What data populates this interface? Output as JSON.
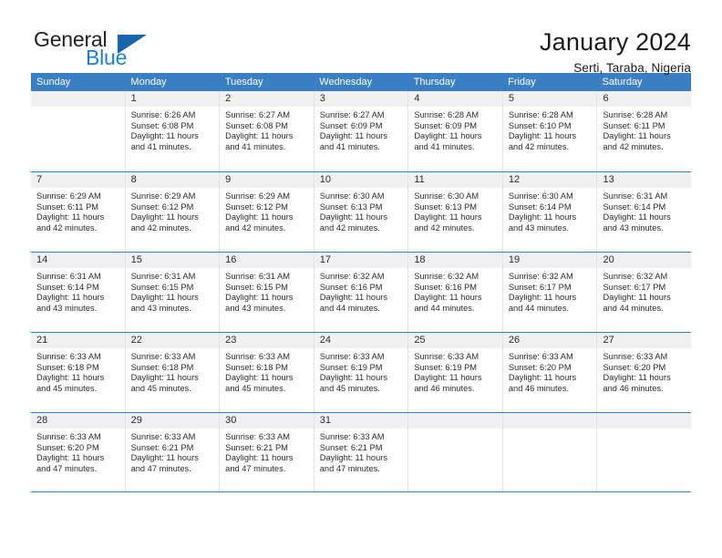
{
  "logo": {
    "general": "General",
    "blue": "Blue",
    "triangle_color": "#1665ad",
    "blue_color": "#1a7fd4"
  },
  "header": {
    "title": "January 2024",
    "subtitle": "Serti, Taraba, Nigeria"
  },
  "theme": {
    "header_row_color": "#3a7fc4",
    "daynum_bg": "#f0f0f0",
    "grid_line": "#e3e3e3"
  },
  "calendar": {
    "weekdays": [
      "Sunday",
      "Monday",
      "Tuesday",
      "Wednesday",
      "Thursday",
      "Friday",
      "Saturday"
    ],
    "weeks": [
      [
        {
          "day": "",
          "lines": []
        },
        {
          "day": "1",
          "lines": [
            "Sunrise: 6:26 AM",
            "Sunset: 6:08 PM",
            "Daylight: 11 hours",
            "and 41 minutes."
          ]
        },
        {
          "day": "2",
          "lines": [
            "Sunrise: 6:27 AM",
            "Sunset: 6:08 PM",
            "Daylight: 11 hours",
            "and 41 minutes."
          ]
        },
        {
          "day": "3",
          "lines": [
            "Sunrise: 6:27 AM",
            "Sunset: 6:09 PM",
            "Daylight: 11 hours",
            "and 41 minutes."
          ]
        },
        {
          "day": "4",
          "lines": [
            "Sunrise: 6:28 AM",
            "Sunset: 6:09 PM",
            "Daylight: 11 hours",
            "and 41 minutes."
          ]
        },
        {
          "day": "5",
          "lines": [
            "Sunrise: 6:28 AM",
            "Sunset: 6:10 PM",
            "Daylight: 11 hours",
            "and 42 minutes."
          ]
        },
        {
          "day": "6",
          "lines": [
            "Sunrise: 6:28 AM",
            "Sunset: 6:11 PM",
            "Daylight: 11 hours",
            "and 42 minutes."
          ]
        }
      ],
      [
        {
          "day": "7",
          "lines": [
            "Sunrise: 6:29 AM",
            "Sunset: 6:11 PM",
            "Daylight: 11 hours",
            "and 42 minutes."
          ]
        },
        {
          "day": "8",
          "lines": [
            "Sunrise: 6:29 AM",
            "Sunset: 6:12 PM",
            "Daylight: 11 hours",
            "and 42 minutes."
          ]
        },
        {
          "day": "9",
          "lines": [
            "Sunrise: 6:29 AM",
            "Sunset: 6:12 PM",
            "Daylight: 11 hours",
            "and 42 minutes."
          ]
        },
        {
          "day": "10",
          "lines": [
            "Sunrise: 6:30 AM",
            "Sunset: 6:13 PM",
            "Daylight: 11 hours",
            "and 42 minutes."
          ]
        },
        {
          "day": "11",
          "lines": [
            "Sunrise: 6:30 AM",
            "Sunset: 6:13 PM",
            "Daylight: 11 hours",
            "and 42 minutes."
          ]
        },
        {
          "day": "12",
          "lines": [
            "Sunrise: 6:30 AM",
            "Sunset: 6:14 PM",
            "Daylight: 11 hours",
            "and 43 minutes."
          ]
        },
        {
          "day": "13",
          "lines": [
            "Sunrise: 6:31 AM",
            "Sunset: 6:14 PM",
            "Daylight: 11 hours",
            "and 43 minutes."
          ]
        }
      ],
      [
        {
          "day": "14",
          "lines": [
            "Sunrise: 6:31 AM",
            "Sunset: 6:14 PM",
            "Daylight: 11 hours",
            "and 43 minutes."
          ]
        },
        {
          "day": "15",
          "lines": [
            "Sunrise: 6:31 AM",
            "Sunset: 6:15 PM",
            "Daylight: 11 hours",
            "and 43 minutes."
          ]
        },
        {
          "day": "16",
          "lines": [
            "Sunrise: 6:31 AM",
            "Sunset: 6:15 PM",
            "Daylight: 11 hours",
            "and 43 minutes."
          ]
        },
        {
          "day": "17",
          "lines": [
            "Sunrise: 6:32 AM",
            "Sunset: 6:16 PM",
            "Daylight: 11 hours",
            "and 44 minutes."
          ]
        },
        {
          "day": "18",
          "lines": [
            "Sunrise: 6:32 AM",
            "Sunset: 6:16 PM",
            "Daylight: 11 hours",
            "and 44 minutes."
          ]
        },
        {
          "day": "19",
          "lines": [
            "Sunrise: 6:32 AM",
            "Sunset: 6:17 PM",
            "Daylight: 11 hours",
            "and 44 minutes."
          ]
        },
        {
          "day": "20",
          "lines": [
            "Sunrise: 6:32 AM",
            "Sunset: 6:17 PM",
            "Daylight: 11 hours",
            "and 44 minutes."
          ]
        }
      ],
      [
        {
          "day": "21",
          "lines": [
            "Sunrise: 6:33 AM",
            "Sunset: 6:18 PM",
            "Daylight: 11 hours",
            "and 45 minutes."
          ]
        },
        {
          "day": "22",
          "lines": [
            "Sunrise: 6:33 AM",
            "Sunset: 6:18 PM",
            "Daylight: 11 hours",
            "and 45 minutes."
          ]
        },
        {
          "day": "23",
          "lines": [
            "Sunrise: 6:33 AM",
            "Sunset: 6:18 PM",
            "Daylight: 11 hours",
            "and 45 minutes."
          ]
        },
        {
          "day": "24",
          "lines": [
            "Sunrise: 6:33 AM",
            "Sunset: 6:19 PM",
            "Daylight: 11 hours",
            "and 45 minutes."
          ]
        },
        {
          "day": "25",
          "lines": [
            "Sunrise: 6:33 AM",
            "Sunset: 6:19 PM",
            "Daylight: 11 hours",
            "and 46 minutes."
          ]
        },
        {
          "day": "26",
          "lines": [
            "Sunrise: 6:33 AM",
            "Sunset: 6:20 PM",
            "Daylight: 11 hours",
            "and 46 minutes."
          ]
        },
        {
          "day": "27",
          "lines": [
            "Sunrise: 6:33 AM",
            "Sunset: 6:20 PM",
            "Daylight: 11 hours",
            "and 46 minutes."
          ]
        }
      ],
      [
        {
          "day": "28",
          "lines": [
            "Sunrise: 6:33 AM",
            "Sunset: 6:20 PM",
            "Daylight: 11 hours",
            "and 47 minutes."
          ]
        },
        {
          "day": "29",
          "lines": [
            "Sunrise: 6:33 AM",
            "Sunset: 6:21 PM",
            "Daylight: 11 hours",
            "and 47 minutes."
          ]
        },
        {
          "day": "30",
          "lines": [
            "Sunrise: 6:33 AM",
            "Sunset: 6:21 PM",
            "Daylight: 11 hours",
            "and 47 minutes."
          ]
        },
        {
          "day": "31",
          "lines": [
            "Sunrise: 6:33 AM",
            "Sunset: 6:21 PM",
            "Daylight: 11 hours",
            "and 47 minutes."
          ]
        },
        {
          "day": "",
          "lines": []
        },
        {
          "day": "",
          "lines": []
        },
        {
          "day": "",
          "lines": []
        }
      ]
    ]
  }
}
